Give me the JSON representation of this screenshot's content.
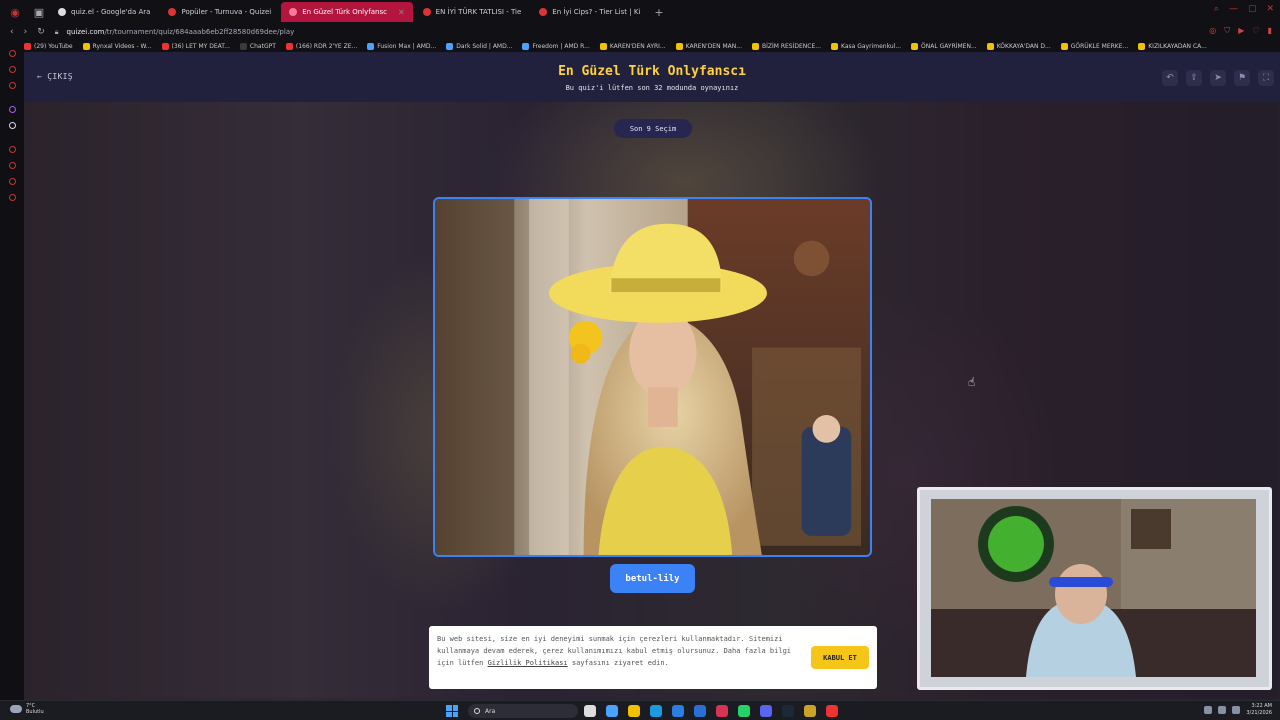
{
  "browser": {
    "tabs": [
      {
        "label": "quiz.el - Google'da Ara",
        "active": false
      },
      {
        "label": "Popüler - Turnuva - Quizei",
        "active": false
      },
      {
        "label": "En Güzel Türk Onlyfansc",
        "active": true
      },
      {
        "label": "EN İYİ TÜRK TATLISI - Tie",
        "active": false
      },
      {
        "label": "En İyi Cips? - Tier List | Ki",
        "active": false
      }
    ],
    "new_tab": "+",
    "url_host": "quizei.com",
    "url_path": "/tr/tournament/quiz/684aaab6eb2ff28580d69dee/play",
    "bookmarks": [
      {
        "label": "(29) YouTube",
        "color": "#e33"
      },
      {
        "label": "Rynxal Videos - W...",
        "color": "#f2c200"
      },
      {
        "label": "(36) LET MY DEAT...",
        "color": "#e33"
      },
      {
        "label": "ChatGPT",
        "color": "#3a3a3a"
      },
      {
        "label": "(166) RDR 2'YE ZE...",
        "color": "#e33"
      },
      {
        "label": "Fusion Max | AMD...",
        "color": "#4aa3ff"
      },
      {
        "label": "Dark Solid | AMD...",
        "color": "#4aa3ff"
      },
      {
        "label": "Freedom | AMD R...",
        "color": "#4aa3ff"
      },
      {
        "label": "KAREN'DEN AYRI...",
        "color": "#f2c200"
      },
      {
        "label": "KAREN'DEN MAN...",
        "color": "#f2c200"
      },
      {
        "label": "BİZİM RESİDENCE...",
        "color": "#f2c200"
      },
      {
        "label": "Kasa Gayrimenkul...",
        "color": "#f2c200"
      },
      {
        "label": "ÖNAL GAYRİMEN...",
        "color": "#f2c200"
      },
      {
        "label": "KÖKKAYA'DAN D...",
        "color": "#f2c200"
      },
      {
        "label": "GÖRÜKLE MERKE...",
        "color": "#f2c200"
      },
      {
        "label": "KIZILKAYADAN CA...",
        "color": "#f2c200"
      }
    ]
  },
  "header": {
    "back_label": "ÇIKIŞ",
    "title": "En Güzel Türk Onlyfanscı",
    "subtitle": "Bu quiz'i lütfen son 32 modunda oynayınız"
  },
  "round_badge": "Son 9 Seçim",
  "contestant": {
    "name": "betul-lily"
  },
  "cookie": {
    "text_before": "Bu web sitesi, size en iyi deneyimi sunmak için çerezleri kullanmaktadır. Sitemizi kullanmaya devam ederek, çerez kullanımımızı kabul etmiş olursunuz. Daha fazla bilgi için lütfen ",
    "link": "Gizlilik Politikası",
    "text_after": " sayfasını ziyaret edin.",
    "accept": "KABUL ET"
  },
  "taskbar": {
    "temp": "7°C",
    "weather": "Bulutlu",
    "search": "Ara",
    "time": "3:22 AM",
    "date": "3/21/2026"
  },
  "colors": {
    "accent": "#3b82f6",
    "title": "#ffd23a",
    "active_tab": "#b3153e",
    "accept": "#f5c518"
  }
}
